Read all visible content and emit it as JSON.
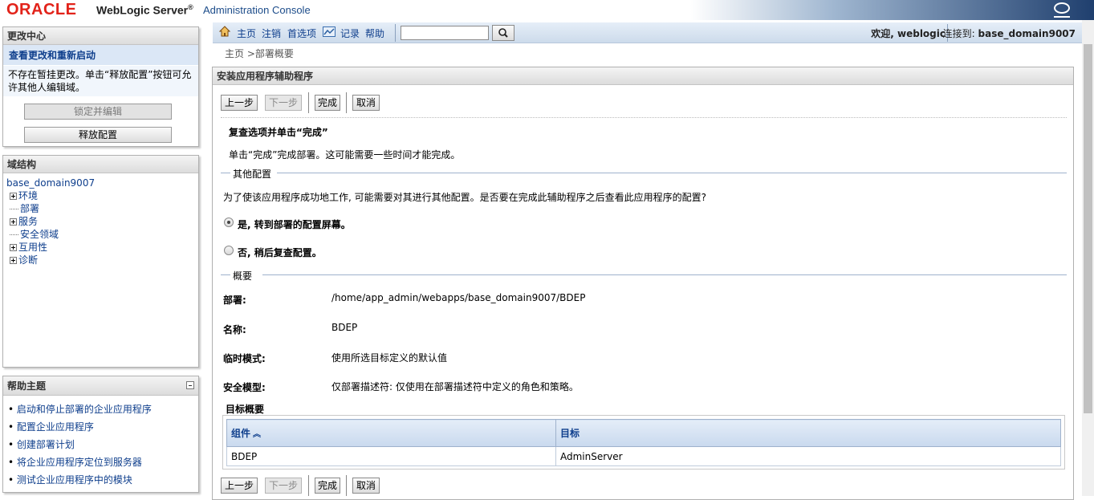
{
  "header": {
    "oracle_logo": "ORACLE",
    "product": "WebLogic Server",
    "registered": "®",
    "console": "Administration Console"
  },
  "change_center": {
    "title": "更改中心",
    "view_changes_link": "查看更改和重新启动",
    "message": "不存在暂挂更改。单击“释放配置”按钮可允许其他人编辑域。",
    "lock_button": "锁定并编辑",
    "release_button": "释放配置"
  },
  "domain_structure": {
    "title": "域结构",
    "root": "base_domain9007",
    "nodes": [
      {
        "label": "环境",
        "expandable": true
      },
      {
        "label": "部署",
        "expandable": false
      },
      {
        "label": "服务",
        "expandable": true
      },
      {
        "label": "安全领域",
        "expandable": false
      },
      {
        "label": "互用性",
        "expandable": true
      },
      {
        "label": "诊断",
        "expandable": true
      }
    ]
  },
  "help_topics": {
    "title": "帮助主题",
    "items": [
      "启动和停止部署的企业应用程序",
      "配置企业应用程序",
      "创建部署计划",
      "将企业应用程序定位到服务器",
      "测试企业应用程序中的模块"
    ]
  },
  "toolbar": {
    "home": "主页",
    "logout": "注销",
    "preferences": "首选项",
    "record": "记录",
    "help": "帮助",
    "search_value": "",
    "welcome": "欢迎, weblogic",
    "connected_label": "连接到:",
    "connected_domain": "base_domain9007"
  },
  "breadcrumb": "主页 >部署概要",
  "wizard": {
    "title": "安装应用程序辅助程序",
    "buttons": {
      "back": "上一步",
      "next": "下一步",
      "finish": "完成",
      "cancel": "取消"
    },
    "step_title": "复查选项并单击“完成”",
    "step_desc": "单击“完成”完成部署。这可能需要一些时间才能完成。",
    "additional_config": {
      "heading": "其他配置",
      "question": "为了使该应用程序成功地工作, 可能需要对其进行其他配置。是否要在完成此辅助程序之后查看此应用程序的配置?",
      "option_yes": "是, 转到部署的配置屏幕。",
      "option_no": "否, 稍后复查配置。",
      "selected": "yes"
    },
    "summary": {
      "heading": "概要",
      "rows": [
        {
          "label": "部署:",
          "value": "/home/app_admin/webapps/base_domain9007/BDEP"
        },
        {
          "label": "名称:",
          "value": "BDEP"
        },
        {
          "label": "临时模式:",
          "value": "使用所选目标定义的默认值"
        },
        {
          "label": "安全模型:",
          "value": "仅部署描述符: 仅使用在部署描述符中定义的角色和策略。"
        }
      ]
    },
    "target_summary": {
      "title": "目标概要",
      "columns": [
        "组件",
        "目标"
      ],
      "rows": [
        [
          "BDEP",
          "AdminServer"
        ]
      ]
    }
  }
}
